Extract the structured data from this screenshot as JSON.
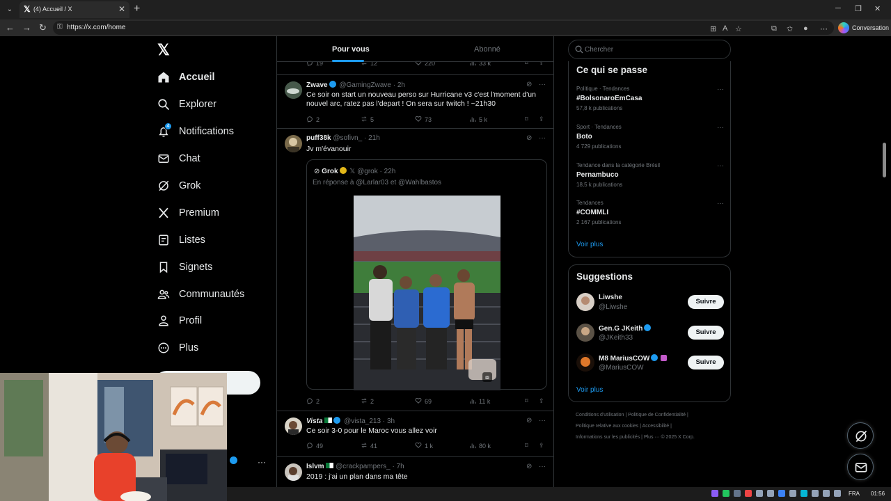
{
  "browser": {
    "tab_title": "(4) Accueil / X",
    "url": "https://x.com/home",
    "conversation_label": "Conversation"
  },
  "sidebar": {
    "items": [
      {
        "label": "Accueil",
        "icon": "home-icon",
        "active": true
      },
      {
        "label": "Explorer",
        "icon": "search-icon"
      },
      {
        "label": "Notifications",
        "icon": "bell-icon",
        "badge": "4"
      },
      {
        "label": "Chat",
        "icon": "mail-icon"
      },
      {
        "label": "Grok",
        "icon": "grok-icon"
      },
      {
        "label": "Premium",
        "icon": "x-icon"
      },
      {
        "label": "Listes",
        "icon": "list-icon"
      },
      {
        "label": "Signets",
        "icon": "bookmark-icon"
      },
      {
        "label": "Communautés",
        "icon": "people-icon"
      },
      {
        "label": "Profil",
        "icon": "person-icon"
      },
      {
        "label": "Plus",
        "icon": "more-circle-icon"
      }
    ]
  },
  "feed": {
    "tabs": [
      {
        "label": "Pour vous",
        "active": true
      },
      {
        "label": "Abonné",
        "active": false
      }
    ],
    "partial_actions": {
      "replies": "19",
      "reposts": "12",
      "likes": "220",
      "views": "33 k"
    },
    "tweets": [
      {
        "name": "Zwave",
        "handle": "@GamingZwave",
        "time": "2h",
        "text": "Ce soir on start un nouveau perso sur Hurricane v3 c'est l'moment d'un nouvel arc, ratez pas l'depart ! On sera sur twitch ! ~21h30",
        "replies": "2",
        "reposts": "5",
        "likes": "73",
        "views": "5 k"
      },
      {
        "name": "puff38k",
        "handle": "@sofivn_",
        "time": "21h",
        "text": "Jv m'évanouir",
        "quote": {
          "name": "Grok",
          "handle": "@grok",
          "time": "22h",
          "reply_prefix": "En réponse à",
          "reply_to_1": "@Larlar03",
          "reply_joiner": "et",
          "reply_to_2": "@Wahlbastos"
        },
        "replies": "2",
        "reposts": "2",
        "likes": "69",
        "views": "11 k"
      },
      {
        "name": "Vista",
        "handle": "@vista_213",
        "time": "3h",
        "text": "Ce soir 3-0 pour le Maroc vous allez voir",
        "replies": "49",
        "reposts": "41",
        "likes": "1 k",
        "views": "80 k"
      },
      {
        "name": "Islvm",
        "handle": "@crackpampers_",
        "time": "7h",
        "text": "2019 : j'ai un plan dans ma tête"
      }
    ]
  },
  "right": {
    "search_placeholder": "Chercher",
    "trends_title": "Ce qui se passe",
    "trends": [
      {
        "category": "Politique · Tendances",
        "name": "#BolsonaroEmCasa",
        "count": "57,8 k publications"
      },
      {
        "category": "Sport · Tendances",
        "name": "Boto",
        "count": "4 729 publications"
      },
      {
        "category": "Tendance dans la catégorie Brésil",
        "name": "Pernambuco",
        "count": "18,5 k publications"
      },
      {
        "category": "Tendances",
        "name": "#COMMLI",
        "count": "2 167 publications"
      }
    ],
    "show_more": "Voir plus",
    "suggestions_title": "Suggestions",
    "suggestions": [
      {
        "name": "Liwshe",
        "handle": "@Liwshe",
        "button": "Suivre"
      },
      {
        "name": "Gen.G JKeith",
        "handle": "@JKeith33",
        "button": "Suivre"
      },
      {
        "name": "M8 MariusCOW",
        "handle": "@MariusCOW",
        "button": "Suivre"
      }
    ],
    "footer": {
      "line1_a": "Conditions d'utilisation",
      "line1_b": "Politique de Confidentialité",
      "line2_a": "Politique relative aux cookies",
      "line2_b": "Accessibilité",
      "line3_a": "Informations sur les publicités",
      "line3_b": "Plus ···",
      "line3_c": "© 2025 X Corp."
    }
  },
  "taskbar": {
    "lang": "FRA",
    "time": "01:56"
  },
  "colors": {
    "accent": "#1d9bf0",
    "background": "#000000",
    "border": "#2f3336",
    "muted": "#71767b"
  }
}
